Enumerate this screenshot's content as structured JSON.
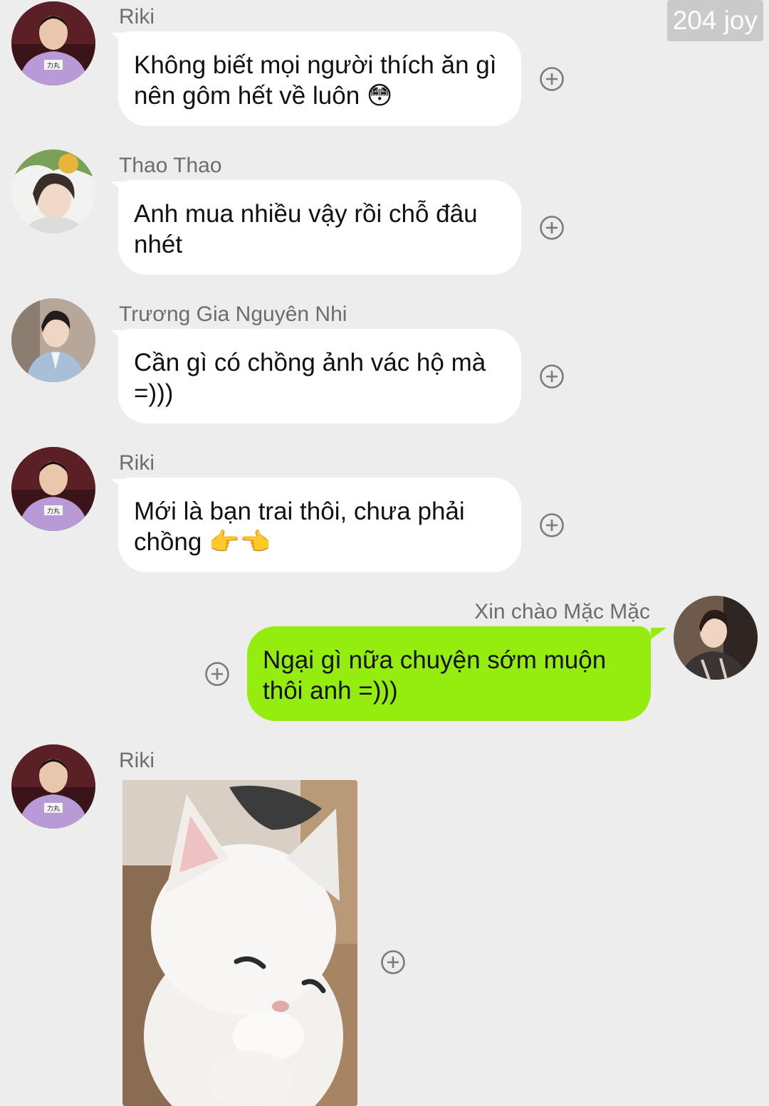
{
  "watermark": "204 joy",
  "messages": [
    {
      "sender": "Riki",
      "line1": "Không biết mọi người thích ăn gì",
      "line2": "nên gôm hết về luôn",
      "emoji": "😳",
      "avatar": "riki-avatar"
    },
    {
      "sender": "Thao Thao",
      "line1": "Anh mua nhiều vậy rồi chỗ đâu",
      "line2": "nhét",
      "avatar": "thao-thao-avatar"
    },
    {
      "sender": "Trương Gia Nguyên Nhi",
      "line1": "Cần gì có chồng ảnh vác hộ mà",
      "line2": "=)))",
      "avatar": "truong-gia-nguyen-nhi-avatar"
    },
    {
      "sender": "Riki",
      "line1": "Mới là bạn trai thôi, chưa phải",
      "line2": "chồng",
      "emoji": "👉👈",
      "avatar": "riki-avatar"
    },
    {
      "sender": "Xin chào Mặc Mặc",
      "line1": "Ngại gì nữa chuyện sớm muộn",
      "line2": "thôi anh =)))",
      "avatar": "self-avatar",
      "outgoing": true
    },
    {
      "sender": "Riki",
      "image": "white-kitten-photo",
      "avatar": "riki-avatar"
    }
  ],
  "colors": {
    "background": "#ededed",
    "incoming_bubble": "#ffffff",
    "outgoing_bubble": "#95ec0f",
    "sender_name": "#6d6d6d"
  },
  "icons": {
    "add_reaction": "plus-circle-icon"
  }
}
